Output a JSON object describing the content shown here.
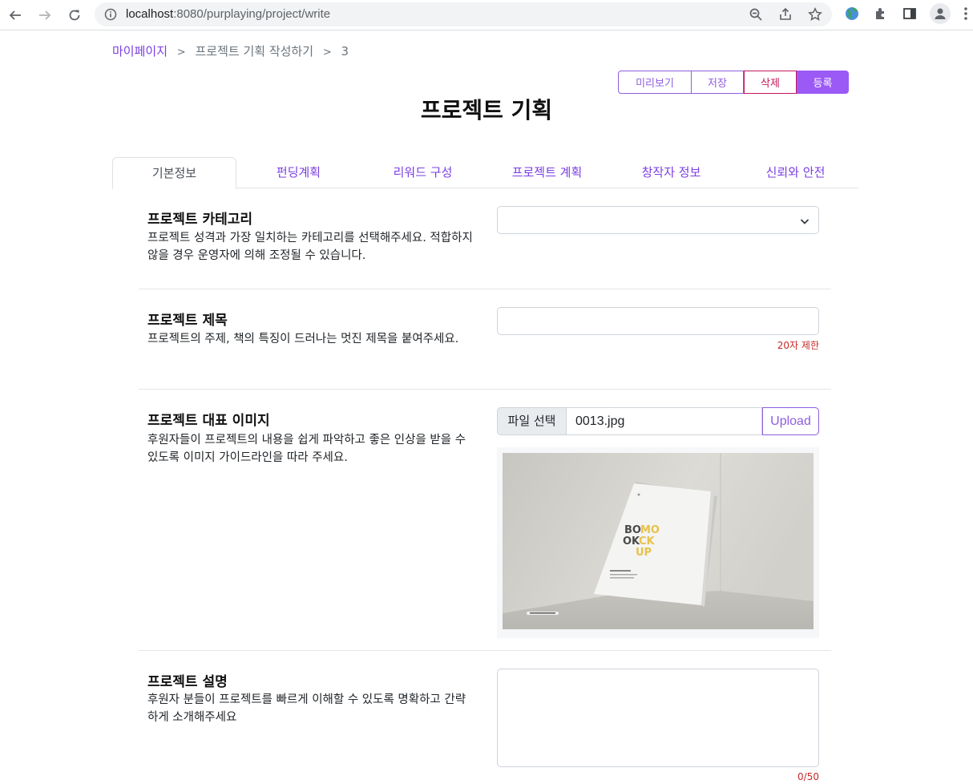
{
  "browser": {
    "url_host": "localhost",
    "url_path": ":8080/purplaying/project/write"
  },
  "breadcrumb": {
    "items": [
      "마이페이지",
      "프로젝트 기획 작성하기",
      "3"
    ],
    "separator": ">"
  },
  "actions": {
    "preview": "미리보기",
    "save": "저장",
    "delete": "삭제",
    "submit": "등록"
  },
  "page_title": "프로젝트 기획",
  "tabs": [
    "기본정보",
    "펀딩계획",
    "리워드 구성",
    "프로젝트 계획",
    "창작자 정보",
    "신뢰와 안전"
  ],
  "active_tab": "기본정보",
  "sections": {
    "category": {
      "title": "프로젝트 카테고리",
      "desc": "프로젝트 성격과 가장 일치하는 카테고리를 선택해주세요. 적합하지 않을 경우 운영자에 의해 조정될 수 있습니다.",
      "value": ""
    },
    "name": {
      "title": "프로젝트 제목",
      "desc": "프로젝트의 주제, 책의 특징이 드러나는 멋진 제목을 붙여주세요.",
      "value": "",
      "limit": "20자 제한"
    },
    "image": {
      "title": "프로젝트 대표 이미지",
      "desc": "후원자들이 프로젝트의 내용을 쉽게 파악하고 좋은 인상을 받을 수 있도록 이미지 가이드라인을 따라 주세요.",
      "choose_label": "파일 선택",
      "file_name": "0013.jpg",
      "upload_label": "Upload",
      "book_text": [
        "BO",
        "MO",
        "OK",
        "CK",
        "UP"
      ]
    },
    "description": {
      "title": "프로젝트 설명",
      "desc": "후원자 분들이 프로젝트를 빠르게 이해할 수 있도록 명확하고 간략하게 소개해주세요",
      "value": "",
      "counter": "0/50"
    }
  },
  "colors": {
    "accent": "#7b3fe4",
    "submit": "#9b59f5",
    "danger": "#c2185b",
    "hint": "#c62828"
  }
}
